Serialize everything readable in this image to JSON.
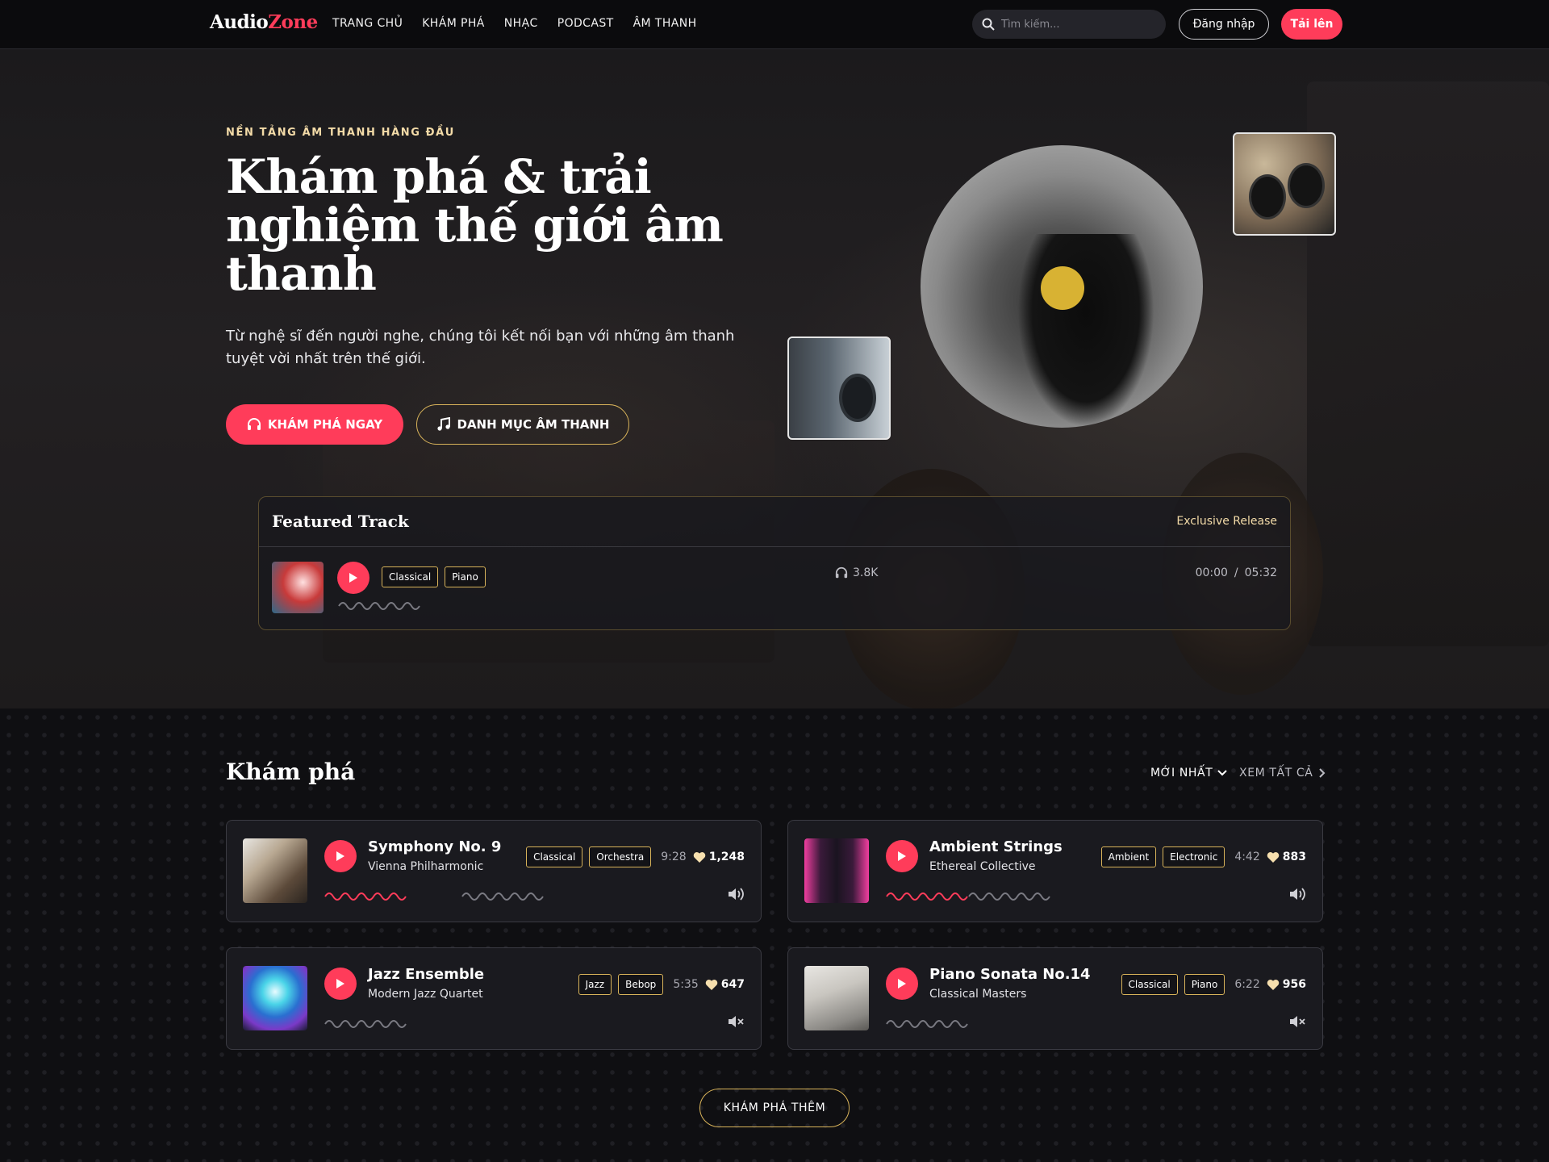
{
  "nav": {
    "logo_a": "Audio",
    "logo_b": "Zone",
    "menu": [
      "TRANG CHỦ",
      "KHÁM PHÁ",
      "NHẠC",
      "PODCAST",
      "ÂM THANH"
    ],
    "search_placeholder": "Tìm kiếm...",
    "login": "Đăng nhập",
    "upload": "Tải lên"
  },
  "hero": {
    "eyebrow": "NỀN TẢNG ÂM THANH HÀNG ĐẦU",
    "title": "Khám phá & trải nghiệm thế giới âm thanh",
    "subtitle": "Từ nghệ sĩ đến người nghe, chúng tôi kết nối bạn với những âm thanh tuyệt vời nhất trên thế giới.",
    "cta_primary": "KHÁM PHÁ NGAY",
    "cta_secondary": "DANH MỤC ÂM THANH"
  },
  "featured": {
    "title": "Featured Track",
    "badge": "Exclusive Release",
    "tags": [
      "Classical",
      "Piano"
    ],
    "listens": "3.8K",
    "current_time": "00:00",
    "separator": "/",
    "duration": "05:32"
  },
  "explore": {
    "title": "Khám phá",
    "sort_label": "MỚI NHẤT",
    "view_all": "XEM TẤT CẢ",
    "more": "KHÁM PHÁ THÊM",
    "tracks": [
      {
        "title": "Symphony No. 9",
        "artist": "Vienna Philharmonic",
        "tags": [
          "Classical",
          "Orchestra"
        ],
        "duration": "9:28",
        "likes": "1,248",
        "volume": "on",
        "progress": 0.5
      },
      {
        "title": "Ambient Strings",
        "artist": "Ethereal Collective",
        "tags": [
          "Ambient",
          "Electronic"
        ],
        "duration": "4:42",
        "likes": "883",
        "volume": "on",
        "progress": 0.5
      },
      {
        "title": "Jazz Ensemble",
        "artist": "Modern Jazz Quartet",
        "tags": [
          "Jazz",
          "Bebop"
        ],
        "duration": "5:35",
        "likes": "647",
        "volume": "muted",
        "progress": 0
      },
      {
        "title": "Piano Sonata No.14",
        "artist": "Classical Masters",
        "tags": [
          "Classical",
          "Piano"
        ],
        "duration": "6:22",
        "likes": "956",
        "volume": "muted",
        "progress": 0
      }
    ]
  },
  "colors": {
    "accent": "#ff3c5a",
    "gold": "#d8b35a",
    "eyebrow": "#f3dba8",
    "background": "#0f0f12"
  },
  "icons": [
    "search-icon",
    "headphones-icon",
    "music-note-icon",
    "play-icon",
    "heart-icon",
    "volume-icon",
    "mute-icon",
    "chevron-down-icon",
    "chevron-right-icon"
  ]
}
